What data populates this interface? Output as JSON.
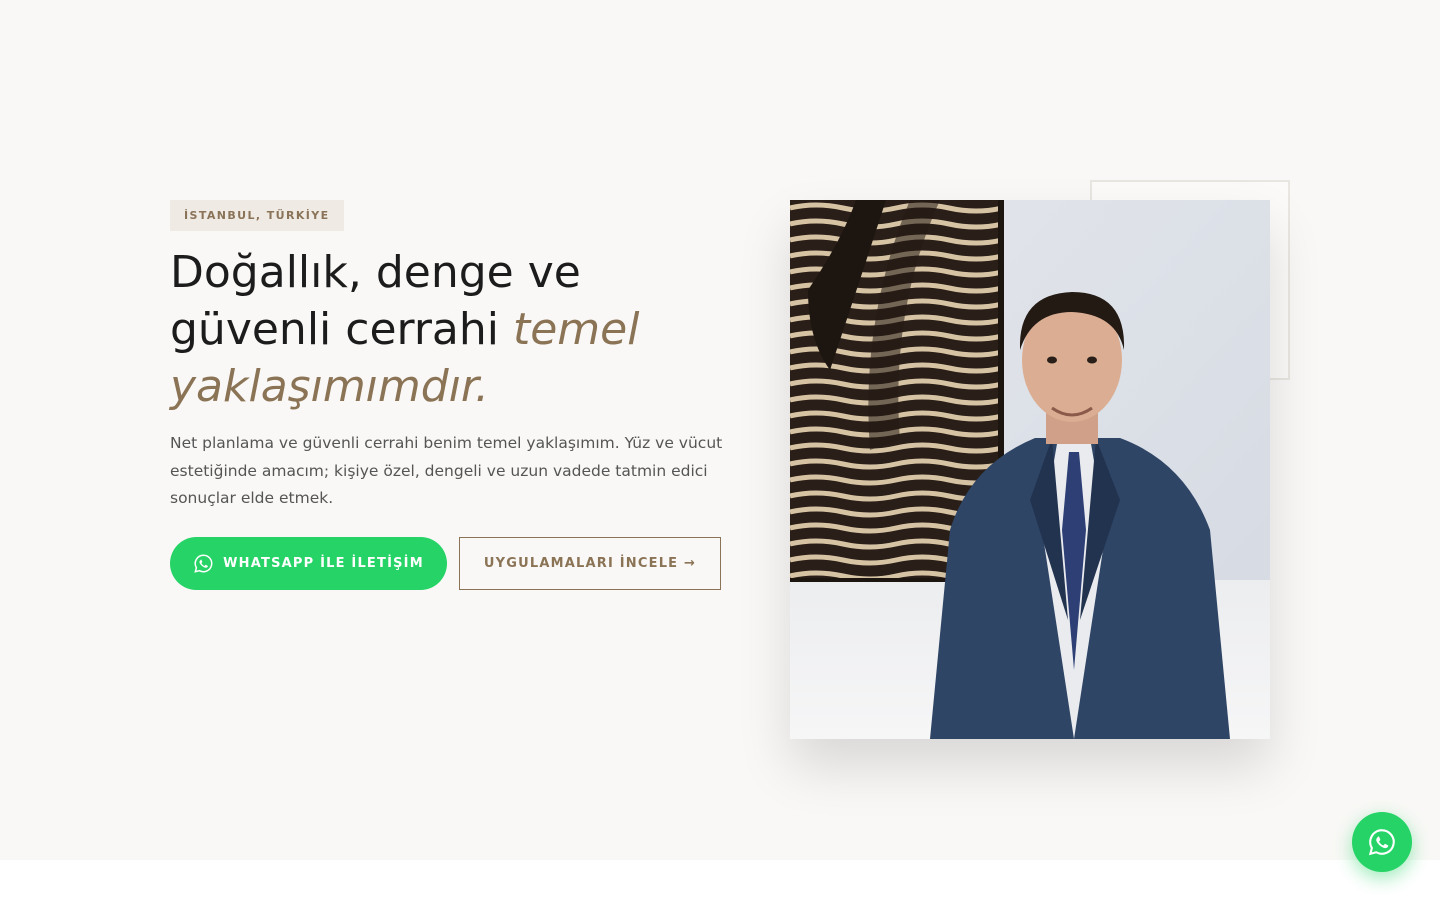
{
  "hero": {
    "badge": "İSTANBUL, TÜRKİYE",
    "headline": {
      "plain": "Doğallık, denge ve güvenli cerrahi ",
      "accent": "temel yaklaşımımdır."
    },
    "lead": "Net planlama ve güvenli cerrahi benim temel yaklaşımım. Yüz ve vücut estetiğinde amacım; kişiye özel, dengeli ve uzun vadede tatmin edici sonuçlar elde etmek.",
    "primary_button": {
      "label": "WHATSAPP İLE İLETİŞİM",
      "icon": "whatsapp-icon"
    },
    "secondary_button": {
      "label": "UYGULAMALARI İNCELE →"
    }
  },
  "floating_button": {
    "icon": "whatsapp-icon"
  },
  "colors": {
    "accent": "#8b7355",
    "whatsapp": "#25d366",
    "hero_background": "#f9f8f6",
    "badge_background": "#efebe4"
  }
}
